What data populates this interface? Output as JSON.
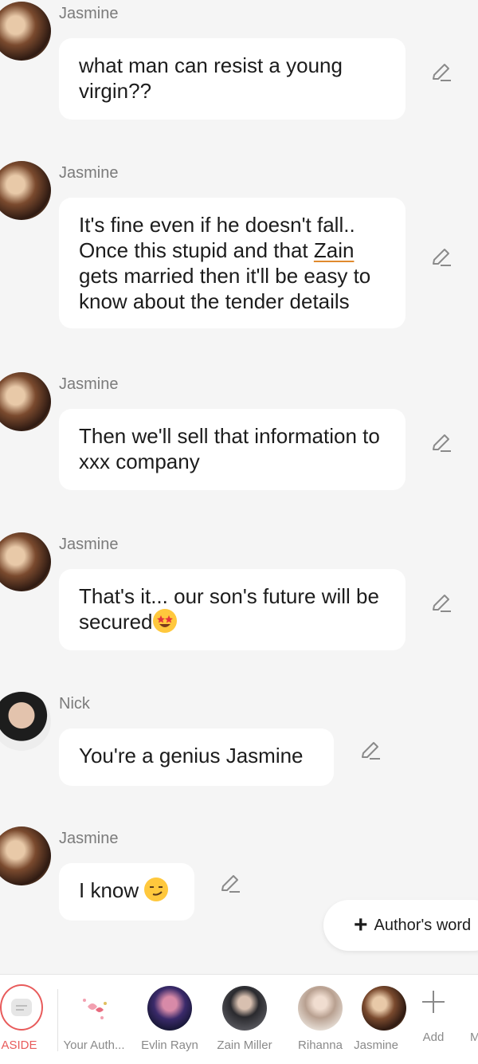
{
  "messages": [
    {
      "sender": "Jasmine",
      "text": "what man can resist a young virgin??"
    },
    {
      "sender": "Jasmine",
      "text_a": "It's fine even if he doesn't fall.. Once this stupid and that ",
      "text_highlight": "Zain",
      "text_b": " gets married then it'll be easy to know about the tender details"
    },
    {
      "sender": "Jasmine",
      "text": "Then we'll sell that information to xxx company"
    },
    {
      "sender": "Jasmine",
      "text": "That's it... our son's future will be secured",
      "emoji": "star-struck-emoji"
    },
    {
      "sender": "Nick",
      "text": "You're a genius Jasmine"
    },
    {
      "sender": "Jasmine",
      "text": "I know ",
      "emoji": "smirk-emoji"
    }
  ],
  "author_button": {
    "label": "Author's word",
    "icon": "plus-icon"
  },
  "bottom_tabs": [
    {
      "label": "ASIDE",
      "active": true
    },
    {
      "label": "Your Auth..."
    },
    {
      "label": "Evlin Rayn"
    },
    {
      "label": "Zain Miller"
    },
    {
      "label": "Rihanna"
    },
    {
      "label": "Jasmine"
    },
    {
      "label": "Add"
    },
    {
      "label": "More"
    }
  ],
  "colors": {
    "accent": "#e85b5b",
    "bubble": "#ffffff",
    "background": "#f5f5f5",
    "highlight_underline": "#e08a2e"
  }
}
